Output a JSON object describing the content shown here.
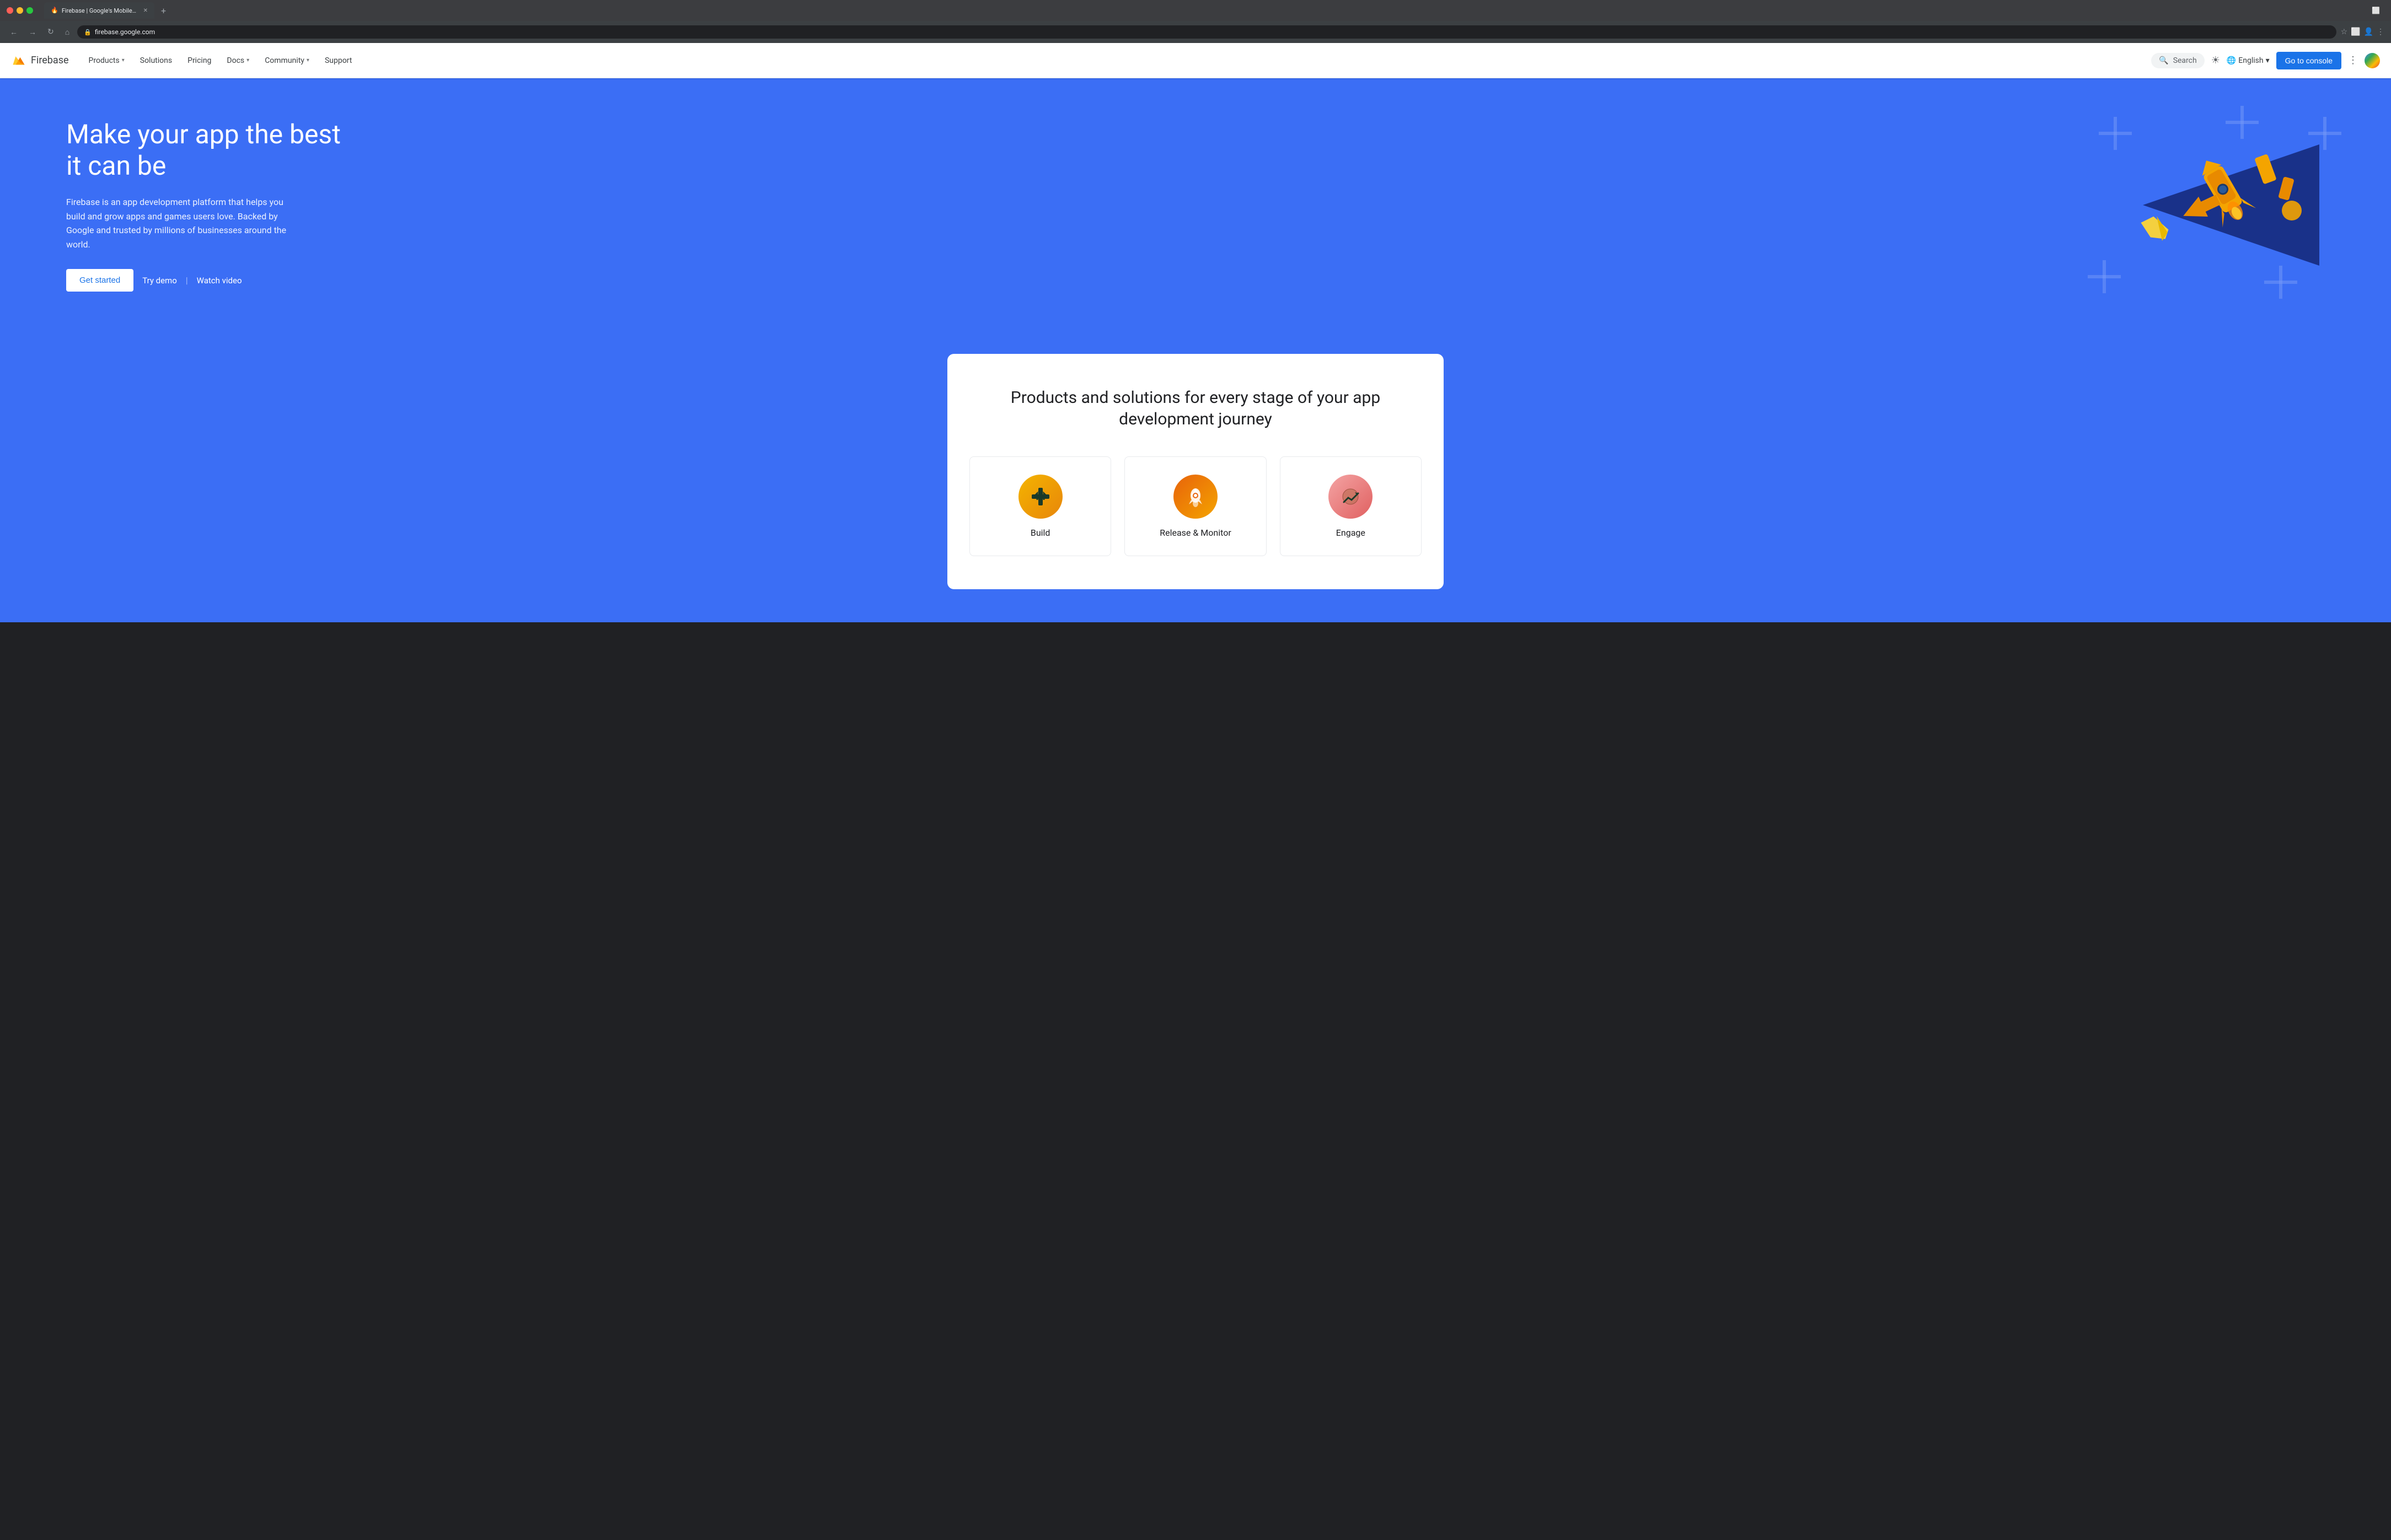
{
  "browser": {
    "tab_title": "Firebase | Google's Mobile ...",
    "tab_favicon": "🔥",
    "url": "firebase.google.com",
    "new_tab_label": "+"
  },
  "nav": {
    "logo_text": "Firebase",
    "links": [
      {
        "label": "Products",
        "has_dropdown": true
      },
      {
        "label": "Solutions",
        "has_dropdown": false
      },
      {
        "label": "Pricing",
        "has_dropdown": false
      },
      {
        "label": "Docs",
        "has_dropdown": true
      },
      {
        "label": "Community",
        "has_dropdown": true
      },
      {
        "label": "Support",
        "has_dropdown": false
      }
    ],
    "search_placeholder": "Search",
    "language": "English",
    "console_label": "Go to console"
  },
  "hero": {
    "title": "Make your app the best it can be",
    "description": "Firebase is an app development platform that helps you build and grow apps and games users love. Backed by Google and trusted by millions of businesses around the world.",
    "cta_primary": "Get started",
    "cta_secondary": "Try demo",
    "cta_tertiary": "Watch video"
  },
  "products_section": {
    "title": "Products and solutions for every stage of your app development journey",
    "products": [
      {
        "name": "Build",
        "icon": "◇",
        "color_class": "icon-build"
      },
      {
        "name": "Release & Monitor",
        "icon": "🚀",
        "color_class": "icon-release"
      },
      {
        "name": "Engage",
        "icon": "📈",
        "color_class": "icon-engage"
      }
    ]
  }
}
